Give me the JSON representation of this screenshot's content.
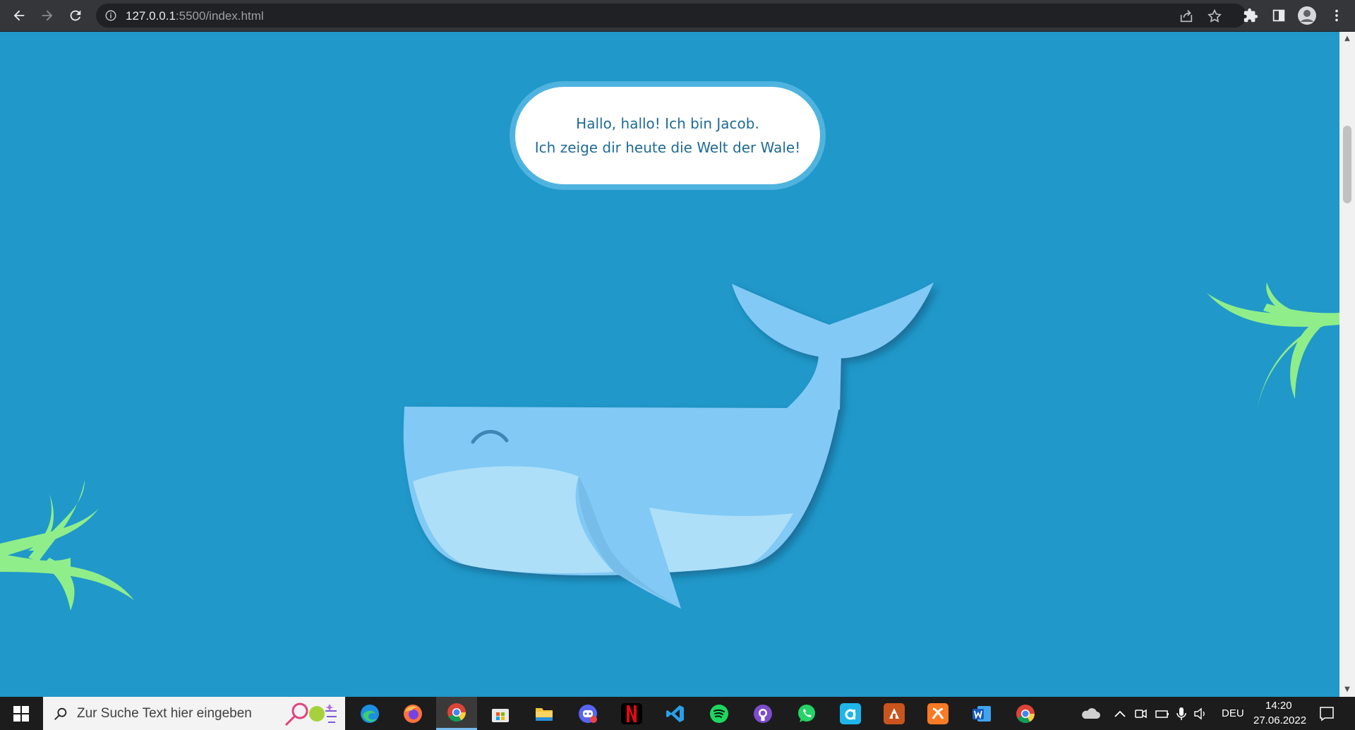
{
  "browser": {
    "url_host": "127.0.0.1",
    "url_rest": ":5500/index.html"
  },
  "page": {
    "speech_line1": "Hallo, hallo! Ich bin Jacob.",
    "speech_line2": "Ich zeige dir heute die Welt der Wale!",
    "colors": {
      "background": "#2098c9",
      "whale_body": "#82c9f5",
      "whale_belly": "#addff9",
      "seaweed": "#8fee8a",
      "bubble_border": "#4fb3df"
    }
  },
  "taskbar": {
    "search_placeholder": "Zur Suche Text hier eingeben",
    "apps": [
      "edge-icon",
      "firefox-icon",
      "chrome-icon",
      "microsoft-store-icon",
      "file-explorer-icon",
      "discord-icon",
      "netflix-icon",
      "vscode-icon",
      "spotify-icon",
      "github-icon",
      "whatsapp-icon",
      "app-icon",
      "office-app-icon",
      "xampp-icon",
      "word-icon",
      "chrome-icon"
    ],
    "language": "DEU",
    "time": "14:20",
    "date": "27.06.2022"
  }
}
